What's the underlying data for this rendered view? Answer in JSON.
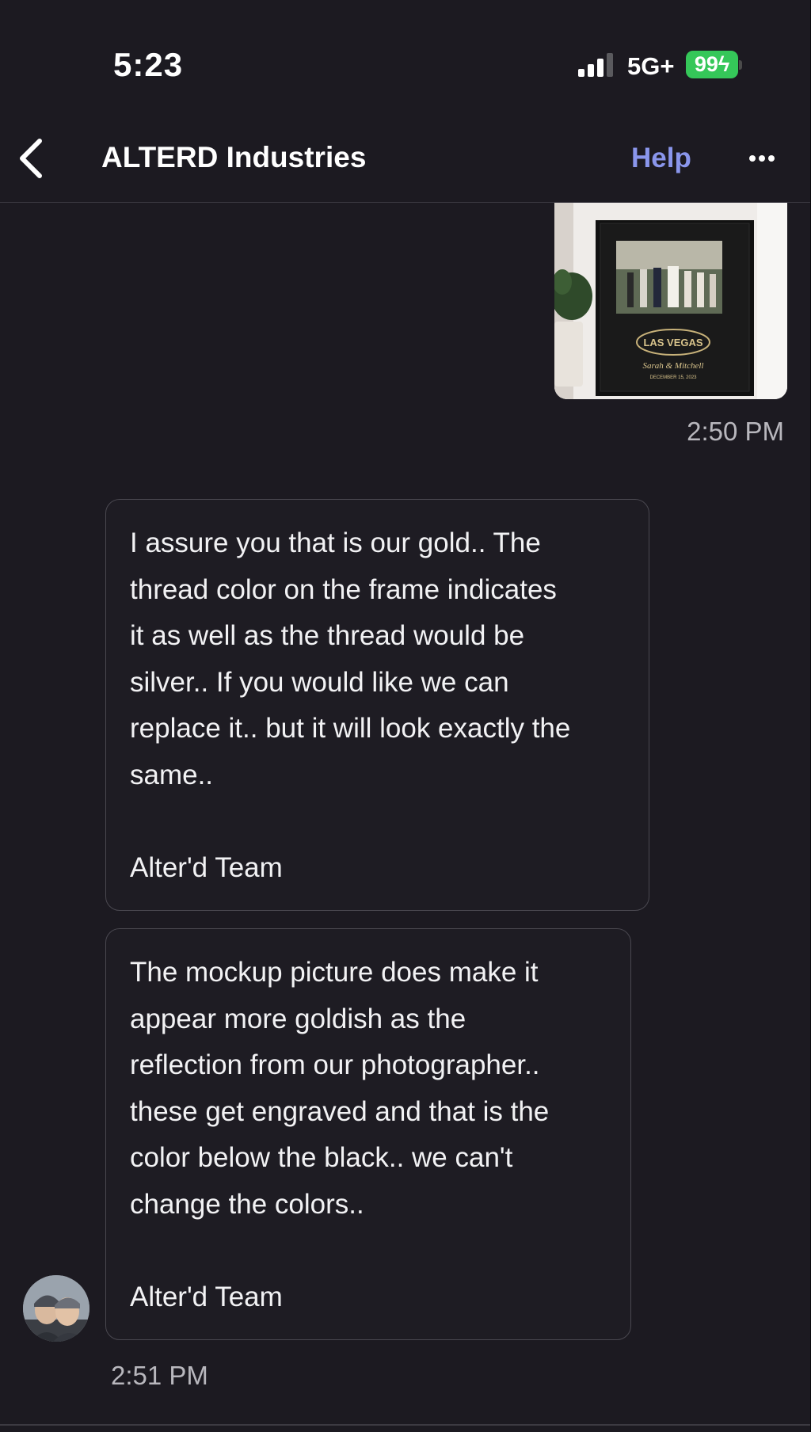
{
  "status_bar": {
    "time": "5:23",
    "network": "5G+",
    "battery": "99"
  },
  "header": {
    "title": "ALTERD Industries",
    "help_label": "Help",
    "back_icon": "chevron-left-icon",
    "more_icon": "ellipsis-icon"
  },
  "image_message": {
    "sign_line": "LAS VEGAS",
    "names": "Sarah & Mitchell",
    "date": "DECEMBER 15, 2023",
    "time": "2:50 PM"
  },
  "messages": [
    {
      "lines": [
        "I assure you that is our gold.. The",
        "thread color on the frame indicates",
        "it as well as the thread would be",
        "silver.. If you would like we can",
        "replace it.. but it will look exactly the",
        "same.."
      ],
      "signature": "Alter'd Team"
    },
    {
      "lines": [
        "The mockup picture does make it",
        "appear more goldish as the",
        "reflection from our photographer..",
        "these get engraved and that is the",
        "color below the black.. we can't",
        "change the colors.."
      ],
      "signature": "Alter'd Team"
    }
  ],
  "received_time": "2:51 PM",
  "colors": {
    "background": "#1c1a21",
    "help_link": "#8a96ec",
    "battery": "#35c759",
    "bubble_border": "#4a4850"
  }
}
